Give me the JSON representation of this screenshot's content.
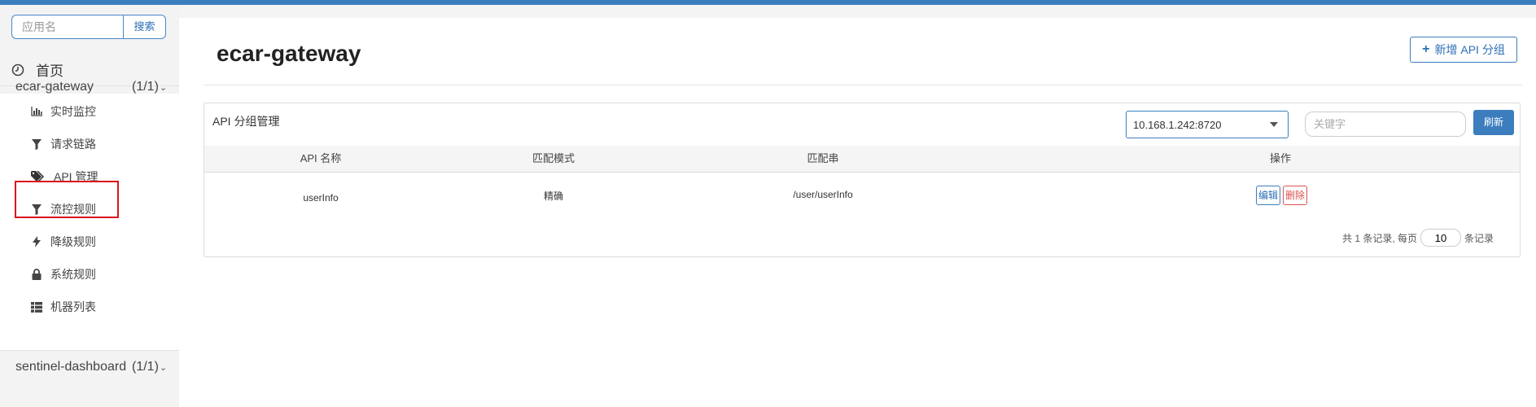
{
  "sidebar": {
    "search": {
      "placeholder": "应用名",
      "button": "搜索"
    },
    "home": {
      "icon": "dashboard-icon",
      "label": "首页"
    },
    "groups": [
      {
        "name": "ecar-gateway",
        "count": "(1/1)",
        "items": [
          {
            "icon": "bar-chart-icon",
            "label": "实时监控"
          },
          {
            "icon": "filter-icon",
            "label": "请求链路"
          },
          {
            "icon": "tags-icon",
            "label": "API 管理",
            "highlighted": true
          },
          {
            "icon": "filter-icon",
            "label": "流控规则"
          },
          {
            "icon": "flash-icon",
            "label": "降级规则"
          },
          {
            "icon": "lock-icon",
            "label": "系统规则"
          },
          {
            "icon": "list-icon",
            "label": "机器列表"
          }
        ]
      },
      {
        "name": "sentinel-dashboard",
        "count": "(1/1)"
      }
    ]
  },
  "main": {
    "title": "ecar-gateway",
    "add_button": "新增 API 分组",
    "panel": {
      "title": "API 分组管理",
      "machine_select": "10.168.1.242:8720",
      "keyword_placeholder": "关键字",
      "refresh_button": "刷新",
      "columns": [
        "API 名称",
        "匹配模式",
        "匹配串",
        "操作"
      ],
      "rows": [
        {
          "api_name": "userInfo",
          "match_mode": "精确",
          "match_string": "/user/userInfo",
          "edit": "编辑",
          "delete": "删除"
        }
      ],
      "pagination": {
        "prefix": "共 1 条记录, 每页",
        "page_size": "10",
        "suffix": "条记录"
      }
    }
  },
  "colors": {
    "primary": "#3c7dbd",
    "danger": "#d9534f",
    "highlight_border": "#d9141b"
  }
}
